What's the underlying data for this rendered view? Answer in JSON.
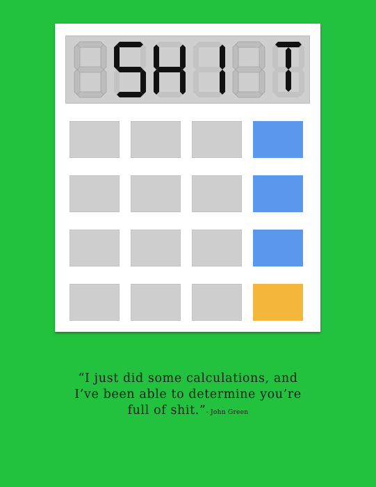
{
  "display": {
    "digits": [
      "0",
      "S",
      "H",
      "I",
      "0",
      "T"
    ],
    "active": [
      false,
      true,
      true,
      true,
      false,
      true
    ],
    "text": "SHIT"
  },
  "keypad": {
    "rows": [
      [
        "gray",
        "gray",
        "gray",
        "blue"
      ],
      [
        "gray",
        "gray",
        "gray",
        "blue"
      ],
      [
        "gray",
        "gray",
        "gray",
        "blue"
      ],
      [
        "gray",
        "gray",
        "gray",
        "orange"
      ]
    ]
  },
  "colors": {
    "background": "#22c13e",
    "key_gray": "#cfcfcf",
    "key_blue": "#5b97ea",
    "key_orange": "#f4b63b",
    "segment_off": "#b8b8b8",
    "segment_on": "#111111"
  },
  "quote": {
    "line1": "“I just did some calculations, and",
    "line2": "I’ve been able to determine you’re",
    "line3": "full of shit.”",
    "author": "- John Green"
  }
}
